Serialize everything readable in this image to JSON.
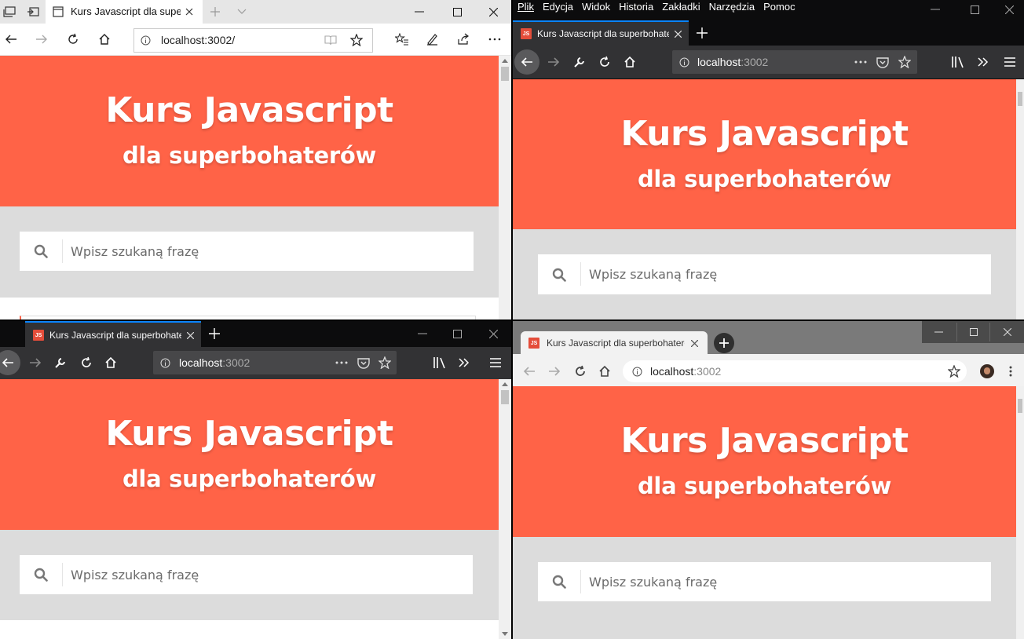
{
  "tab_title_short": "Kurs Javascript dla supe",
  "tab_title_long": "Kurs Javascript dla superbohaterów",
  "url_edge": "localhost:3002/",
  "url_host": "localhost",
  "url_port": ":3002",
  "js_badge": "JS",
  "hero_title": "Kurs Javascript",
  "hero_subtitle": "dla superbohaterów",
  "search_placeholder": "Wpisz szukaną frazę",
  "firefox_menu": [
    "Plik",
    "Edycja",
    "Widok",
    "Historia",
    "Zakładki",
    "Narzędzia",
    "Pomoc"
  ],
  "colors": {
    "hero": "#ff6347",
    "gray": "#dcdcdc",
    "firefox_dark": "#323234",
    "chrome_frame": "#7a7a7a"
  }
}
